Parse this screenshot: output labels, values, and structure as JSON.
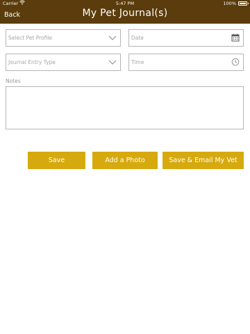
{
  "status_bar": {
    "carrier": "Carrier",
    "time": "5:47 PM",
    "battery": "100%"
  },
  "nav": {
    "back_label": "Back",
    "title": "My Pet Journal(s)"
  },
  "form": {
    "pet_profile_placeholder": "Select Pet Profile",
    "date_placeholder": "Date",
    "entry_type_placeholder": "Journal Entry Type",
    "time_placeholder": "Time",
    "notes_label": "Notes",
    "notes_value": ""
  },
  "actions": {
    "save_label": "Save",
    "add_photo_label": "Add a Photo",
    "save_email_label": "Save & Email My Vet"
  },
  "colors": {
    "nav_background": "#5b3c0c",
    "button_background": "#d6aa0e"
  },
  "icons": {
    "pet_profile_dropdown": "chevron-down-icon",
    "date_field": "calendar-icon",
    "entry_type_dropdown": "chevron-down-icon",
    "time_field": "clock-icon"
  }
}
